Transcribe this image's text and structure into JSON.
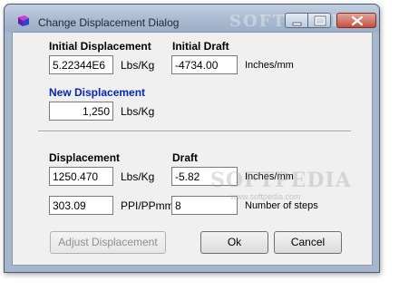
{
  "window": {
    "title": "Change Displacement Dialog",
    "title_watermark": "SOFTPEDIA",
    "body_watermark": "SOFTPEDIA",
    "body_watermark_url": "www.softpedia.com",
    "accent_color": "#0a24b4"
  },
  "initial": {
    "displacement_label": "Initial Displacement",
    "displacement_value": "5.22344E6",
    "displacement_unit": "Lbs/Kg",
    "draft_label": "Initial Draft",
    "draft_value": "-4734.00",
    "draft_unit": "Inches/mm"
  },
  "new_displacement": {
    "label": "New Displacement",
    "value": "1,250",
    "unit": "Lbs/Kg"
  },
  "result": {
    "displacement_label": "Displacement",
    "displacement_value": "1250.470",
    "displacement_unit": "Lbs/Kg",
    "draft_label": "Draft",
    "draft_value": "-5.82",
    "draft_unit": "Inches/mm",
    "ppi_value": "303.09",
    "ppi_unit": "PPI/PPmm",
    "steps_value": "8",
    "steps_unit": "Number of steps"
  },
  "buttons": {
    "adjust": "Adjust Displacement",
    "ok": "Ok",
    "cancel": "Cancel"
  }
}
